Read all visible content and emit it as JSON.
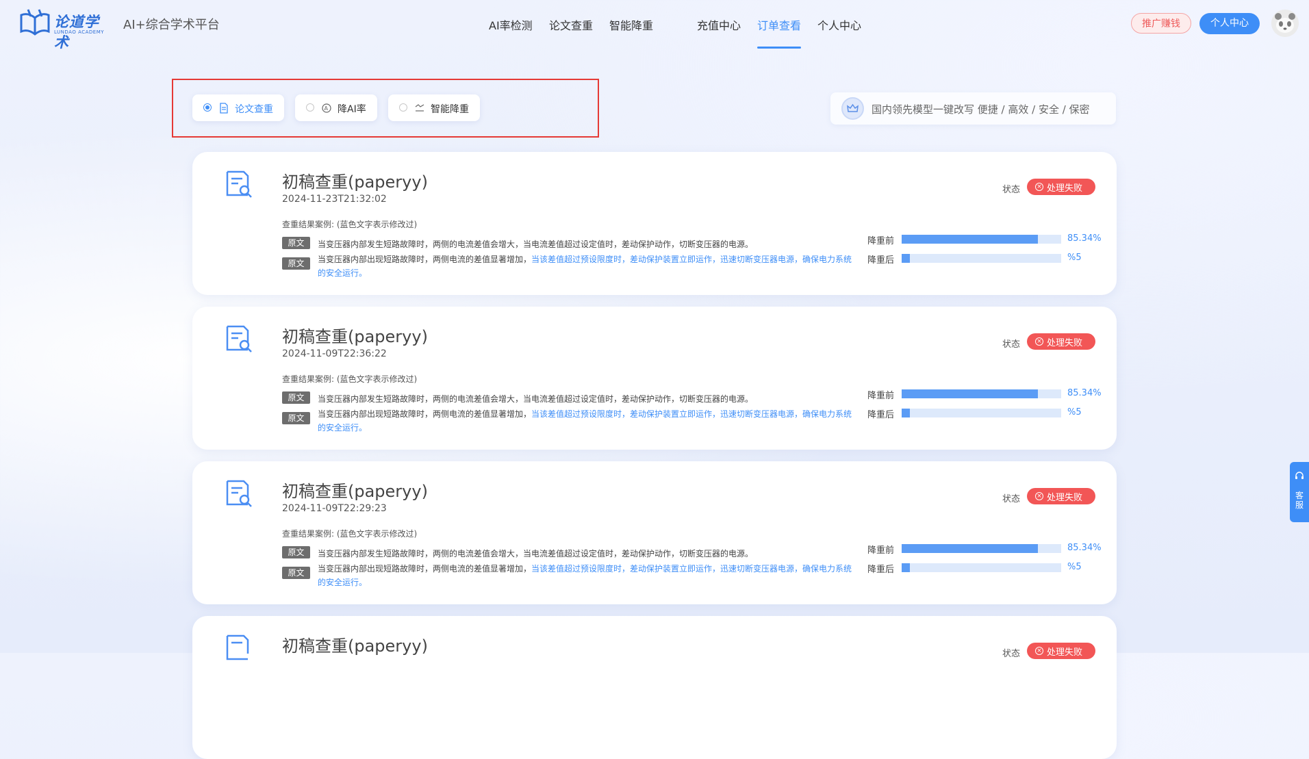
{
  "header": {
    "logo_text": "论道学术",
    "logo_sub": "LUNDAO ACADEMY",
    "platform": "AI+综合学术平台",
    "nav": [
      "AI率检测",
      "论文查重",
      "智能降重",
      "充值中心",
      "订单查看",
      "个人中心"
    ],
    "active_nav": "订单查看",
    "promo_button": "推广赚钱",
    "user_button": "个人中心"
  },
  "tabs": [
    {
      "label": "论文查重",
      "active": true,
      "icon": "document-icon"
    },
    {
      "label": "降AI率",
      "active": false,
      "icon": "ai-icon"
    },
    {
      "label": "智能降重",
      "active": false,
      "icon": "reduce-icon"
    }
  ],
  "promo_banner": {
    "icon": "crown-icon",
    "text": "国内领先模型一键改写 便捷 / 高效 / 安全 / 保密"
  },
  "orders": [
    {
      "title": "初稿查重(paperyy)",
      "date": "2024-11-23T21:32:02",
      "case_label": "查重结果案例:  (蓝色文字表示修改过)",
      "tag": "原文",
      "line1": "当变压器内部发生短路故障时，两侧的电流差值会增大，当电流差值超过设定值时，差动保护动作，切断变压器的电源。",
      "line2_plain": "当变压器内部出现短路故障时，两侧电流的差值显著增加，",
      "line2_blue": "当该差值超过预设限度时，差动保护装置立即运作，迅速切断变压器电源，确保电力系统的安全运行。",
      "status_label": "状态",
      "status": "处理失败",
      "before_label": "降重前",
      "before_value": "85.34%",
      "before_fraction": 0.8534,
      "after_label": "降重后",
      "after_value": "%5",
      "after_fraction": 0.05
    },
    {
      "title": "初稿查重(paperyy)",
      "date": "2024-11-09T22:36:22",
      "case_label": "查重结果案例:  (蓝色文字表示修改过)",
      "tag": "原文",
      "line1": "当变压器内部发生短路故障时，两侧的电流差值会增大，当电流差值超过设定值时，差动保护动作，切断变压器的电源。",
      "line2_plain": "当变压器内部出现短路故障时，两侧电流的差值显著增加，",
      "line2_blue": "当该差值超过预设限度时，差动保护装置立即运作，迅速切断变压器电源，确保电力系统的安全运行。",
      "status_label": "状态",
      "status": "处理失败",
      "before_label": "降重前",
      "before_value": "85.34%",
      "before_fraction": 0.8534,
      "after_label": "降重后",
      "after_value": "%5",
      "after_fraction": 0.05
    },
    {
      "title": "初稿查重(paperyy)",
      "date": "2024-11-09T22:29:23",
      "case_label": "查重结果案例:  (蓝色文字表示修改过)",
      "tag": "原文",
      "line1": "当变压器内部发生短路故障时，两侧的电流差值会增大，当电流差值超过设定值时，差动保护动作，切断变压器的电源。",
      "line2_plain": "当变压器内部出现短路故障时，两侧电流的差值显著增加，",
      "line2_blue": "当该差值超过预设限度时，差动保护装置立即运作，迅速切断变压器电源，确保电力系统的安全运行。",
      "status_label": "状态",
      "status": "处理失败",
      "before_label": "降重前",
      "before_value": "85.34%",
      "before_fraction": 0.8534,
      "after_label": "降重后",
      "after_value": "%5",
      "after_fraction": 0.05
    },
    {
      "title": "初稿查重(paperyy)",
      "status_label": "状态",
      "status": "处理失败"
    }
  ],
  "customer_service": {
    "label": "客服",
    "icon": "headset-icon"
  },
  "colors": {
    "accent": "#3e8ef7",
    "danger": "#f25656",
    "tag_bg": "#6d6d6d"
  }
}
